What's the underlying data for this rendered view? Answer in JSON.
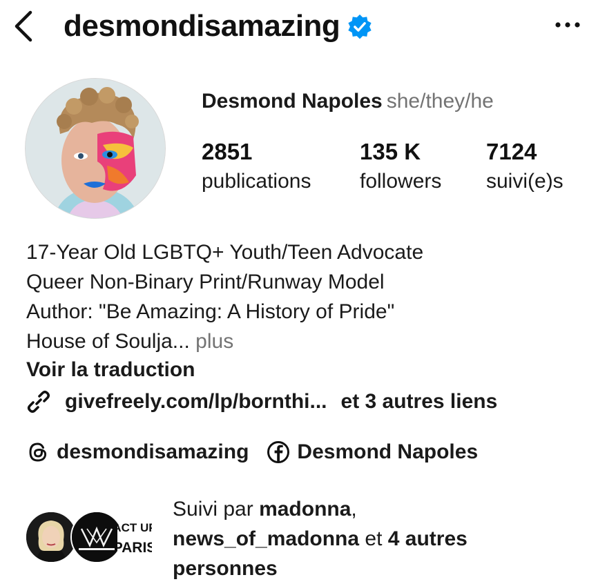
{
  "header": {
    "username": "desmondisamazing",
    "verified_icon": "verified-badge-icon",
    "back_icon": "chevron-left-icon",
    "more_icon": "more-horizontal-icon"
  },
  "profile": {
    "full_name": "Desmond Napoles",
    "pronouns": "she/they/he",
    "stats": {
      "publications": {
        "value": "2851",
        "label": "publications"
      },
      "followers": {
        "value": "135 K",
        "label": "followers"
      },
      "following": {
        "value": "7124",
        "label": "suivi(e)s"
      }
    }
  },
  "bio": {
    "line1": "17-Year Old LGBTQ+ Youth/Teen Advocate",
    "line2": "Queer Non-Binary Print/Runway Model",
    "line3": "Author: \"Be Amazing: A History of Pride\"",
    "line4": "House of Soulja...",
    "more": "plus",
    "translate": "Voir la traduction"
  },
  "links": {
    "icon": "link-icon",
    "url": "givefreely.com/lp/bornthi...",
    "others": "et 3 autres liens"
  },
  "social": {
    "threads": {
      "icon": "threads-icon",
      "label": "desmondisamazing"
    },
    "facebook": {
      "icon": "facebook-icon",
      "label": "Desmond Napoles"
    }
  },
  "followed_by": {
    "prefix": "Suivi par",
    "user1": "madonna",
    "comma": ",",
    "user2": "news_of_madonna",
    "conj": "et",
    "others": "4 autres",
    "others2": "personnes",
    "act_up_logo": [
      "ACT UP",
      "PARIS"
    ]
  },
  "colors": {
    "verified_blue": "#0095f6",
    "secondary_text": "#737373",
    "primary_text": "#1a1a1a"
  }
}
